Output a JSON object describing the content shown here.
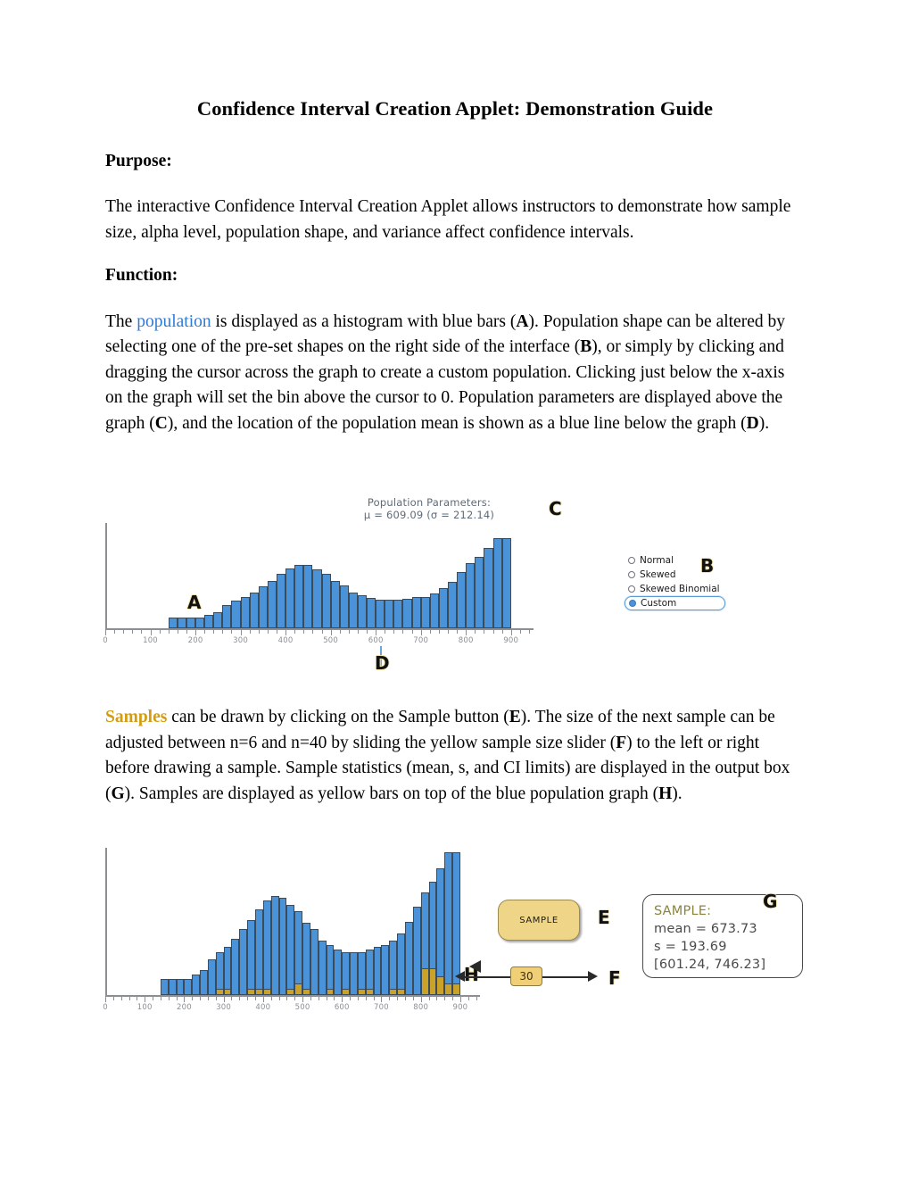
{
  "document": {
    "title": "Confidence Interval Creation Applet: Demonstration Guide",
    "sections": [
      {
        "heading": "Purpose:",
        "paragraph": "The interactive Confidence Interval Creation Applet allows instructors to demonstrate how sample size, alpha level, population shape, and variance affect confidence intervals."
      },
      {
        "heading": "Function:",
        "paragraph_parts": {
          "p1": "The ",
          "kw": "population",
          "p2": " is displayed as a histogram with blue bars (",
          "a": "A",
          "p3": "). Population shape can be altered by selecting one of the pre-set shapes on the right side of the interface (",
          "b": "B",
          "p4": "), or simply by clicking and dragging the cursor across the graph to create a custom population. Clicking just below the x-axis on the graph will set the bin above the cursor to 0. Population parameters are displayed above the graph (",
          "c": "C",
          "p5": "), and the location of the population mean is shown as a blue line below the graph (",
          "d": "D",
          "p6": ")."
        }
      }
    ],
    "samples_paragraph": {
      "kw": "Samples",
      "p1": " can be drawn by clicking on the Sample button (",
      "e": "E",
      "p2": "). The size of the next sample can be adjusted between n=6 and n=40 by sliding the yellow sample size slider (",
      "f": "F",
      "p3": ") to the left or right before drawing a sample. Sample statistics (mean, s, and CI limits) are displayed in the output box (",
      "g": "G",
      "p4": "). Samples are displayed as yellow bars on top of the blue population graph (",
      "h": "H",
      "p5": ")."
    }
  },
  "figure1": {
    "labels": {
      "population_parameters_title": "Population Parameters:",
      "population_parameters_values": "μ = 609.09 (σ = 212.14)",
      "marker_a": "A",
      "marker_b": "B",
      "marker_c": "C",
      "marker_d": "D"
    },
    "shape_options": [
      {
        "label": "Normal",
        "selected": false
      },
      {
        "label": "Skewed",
        "selected": false
      },
      {
        "label": "Skewed Binomial",
        "selected": false
      },
      {
        "label": "Custom",
        "selected": true
      }
    ]
  },
  "figure2": {
    "labels": {
      "marker_e": "E",
      "marker_f": "F",
      "marker_g": "G",
      "marker_h": "H"
    },
    "sample_button_label": "SAMPLE",
    "sample_size_value": "30",
    "output_box": {
      "title": "SAMPLE:",
      "mean": "mean = 673.73",
      "s": "s = 193.69",
      "ci": "[601.24, 746.23]"
    }
  },
  "colors": {
    "population_bar": "#4a93d9",
    "sample_bar": "#c9a227",
    "bar_outline": "#3c4b5a",
    "mean_line": "#6ba6dc",
    "axis": "#8b8f94",
    "tick_label": "#8b8f94",
    "param_text": "#5f6b78",
    "keyword_blue": "#2e7bd6",
    "keyword_gold": "#d39c12",
    "sample_button": "#eed588",
    "slider_thumb": "#f1cf76",
    "radio_selected": "#4a93d9"
  },
  "chart_data": [
    {
      "type": "bar",
      "id": "population-histogram",
      "title": "Population Parameters: μ = 609.09 (σ = 212.14)",
      "xlabel": "",
      "ylabel": "",
      "xlim": [
        0,
        950
      ],
      "ylim": [
        0,
        100
      ],
      "grid": false,
      "legend": null,
      "bin_width": 20,
      "annotations": [
        {
          "text": "A",
          "x": 250
        },
        {
          "text": "C",
          "x": 640
        },
        {
          "text": "D",
          "x": 609.09,
          "note": "population mean line below axis"
        }
      ],
      "tick_labels": [
        "0",
        "100",
        "200",
        "300",
        "400",
        "500",
        "600",
        "700",
        "800",
        "900"
      ],
      "tick_values": [
        0,
        100,
        200,
        300,
        400,
        500,
        600,
        700,
        800,
        900
      ],
      "x": [
        150,
        170,
        190,
        210,
        230,
        250,
        270,
        290,
        310,
        330,
        350,
        370,
        390,
        410,
        430,
        450,
        470,
        490,
        510,
        530,
        550,
        570,
        590,
        610,
        630,
        650,
        670,
        690,
        710,
        730,
        750,
        770,
        790,
        810,
        830,
        850,
        870,
        890
      ],
      "values": [
        10,
        10,
        10,
        10,
        13,
        15,
        22,
        26,
        30,
        34,
        40,
        45,
        52,
        57,
        60,
        60,
        56,
        52,
        45,
        41,
        34,
        31,
        29,
        27,
        27,
        27,
        28,
        30,
        30,
        33,
        38,
        44,
        53,
        62,
        68,
        76,
        86,
        86
      ]
    },
    {
      "type": "bar",
      "id": "population-with-sample-histogram",
      "title": "",
      "xlabel": "",
      "ylabel": "",
      "xlim": [
        0,
        950
      ],
      "ylim": [
        0,
        100
      ],
      "grid": false,
      "legend": [
        "population",
        "sample"
      ],
      "bin_width": 20,
      "annotations": [
        {
          "text": "H",
          "x": 910,
          "note": "points to yellow sample bars"
        }
      ],
      "tick_labels": [
        "0",
        "100",
        "200",
        "300",
        "400",
        "500",
        "600",
        "700",
        "800",
        "900"
      ],
      "tick_values": [
        0,
        100,
        200,
        300,
        400,
        500,
        600,
        700,
        800,
        900
      ],
      "x": [
        150,
        170,
        190,
        210,
        230,
        250,
        270,
        290,
        310,
        330,
        350,
        370,
        390,
        410,
        430,
        450,
        470,
        490,
        510,
        530,
        550,
        570,
        590,
        610,
        630,
        650,
        670,
        690,
        710,
        730,
        750,
        770,
        790,
        810,
        830,
        850,
        870,
        890
      ],
      "series": [
        {
          "name": "population",
          "values": [
            11,
            11,
            11,
            11,
            14,
            17,
            24,
            29,
            33,
            38,
            45,
            51,
            58,
            64,
            67,
            66,
            61,
            57,
            49,
            45,
            37,
            34,
            31,
            29,
            29,
            29,
            31,
            33,
            34,
            37,
            42,
            50,
            60,
            70,
            77,
            86,
            97,
            97
          ]
        },
        {
          "name": "sample",
          "values": [
            0,
            0,
            0,
            0,
            0,
            0,
            0,
            4,
            4,
            0,
            0,
            4,
            4,
            4,
            0,
            0,
            4,
            8,
            4,
            0,
            0,
            4,
            0,
            4,
            0,
            4,
            4,
            0,
            0,
            4,
            4,
            0,
            0,
            18,
            18,
            13,
            8,
            8
          ]
        }
      ]
    }
  ]
}
